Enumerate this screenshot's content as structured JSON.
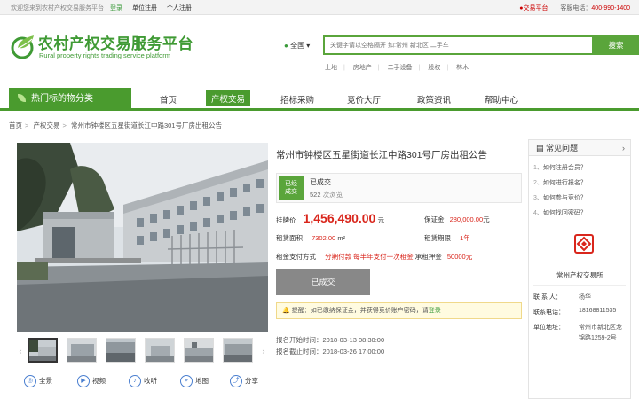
{
  "topbar": {
    "welcome": "欢迎您来到农村产权交易服务平台",
    "login": "登录",
    "register_org": "单位注册",
    "register_person": "个人注册",
    "platform": "●交易平台",
    "hotline_label": "客服电话：",
    "hotline": "400-990-1400"
  },
  "logo": {
    "cn": "农村产权交易服务平台",
    "en": "Rural property rights trading service platform"
  },
  "search": {
    "region": "全国",
    "placeholder": "关键字请以空格隔开 如:常州 新北区 二手车",
    "button": "搜索",
    "hot_words": [
      "土地",
      "房地产",
      "二手设备",
      "股权",
      "林木"
    ]
  },
  "nav": {
    "category": "热门标的物分类",
    "items": [
      "首页",
      "产权交易",
      "招标采购",
      "竞价大厅",
      "政策资讯",
      "帮助中心"
    ],
    "active_index": 1
  },
  "breadcrumb": [
    "首页",
    "产权交易",
    "常州市钟楼区五星街道长江中路301号厂房出租公告"
  ],
  "listing": {
    "title": "常州市钟楼区五星街道长江中路301号厂房出租公告",
    "badge": "已经\n成交",
    "status": "已成交",
    "views": "522",
    "views_suffix": "次浏览",
    "price_label": "挂牌价",
    "price": "1,456,490.00",
    "price_unit": "元",
    "deposit_label": "保证金",
    "deposit": "280,000.00",
    "deposit_unit": "元",
    "area_label": "租赁面积",
    "area": "7302.00",
    "area_unit": "m²",
    "term_label": "租赁期限",
    "term": "1年",
    "pay_label": "租金支付方式",
    "pay": "分期付款 每半年支付一次租金",
    "pledge_label": "承租押金",
    "pledge": "50000元",
    "done_button": "已成交",
    "tip_prefix": "提醒：如已缴纳保证金，并获得竞价账户密码，请",
    "tip_link": "登录",
    "start_label": "报名开始时间：",
    "start": "2018-03-13 08:30:00",
    "end_label": "报名截止时间：",
    "end": "2018-03-26 17:00:00"
  },
  "media": [
    "全景",
    "视频",
    "收听",
    "地图",
    "分享"
  ],
  "faq": {
    "title": "常见问题",
    "items": [
      "如何注册会员？",
      "如何进行报名？",
      "如何参与竞价？",
      "如何找回密码？"
    ]
  },
  "org": {
    "name": "常州产权交易所",
    "contact_label": "联 系 人：",
    "contact": "杨华",
    "phone_label": "联系电话：",
    "phone": "18168811535",
    "address_label": "单位地址：",
    "address_line1": "常州市新北区龙",
    "address_line2": "锦路1259-2号"
  },
  "colors": {
    "accent": "#4a9b2e",
    "price": "#d9261c"
  }
}
